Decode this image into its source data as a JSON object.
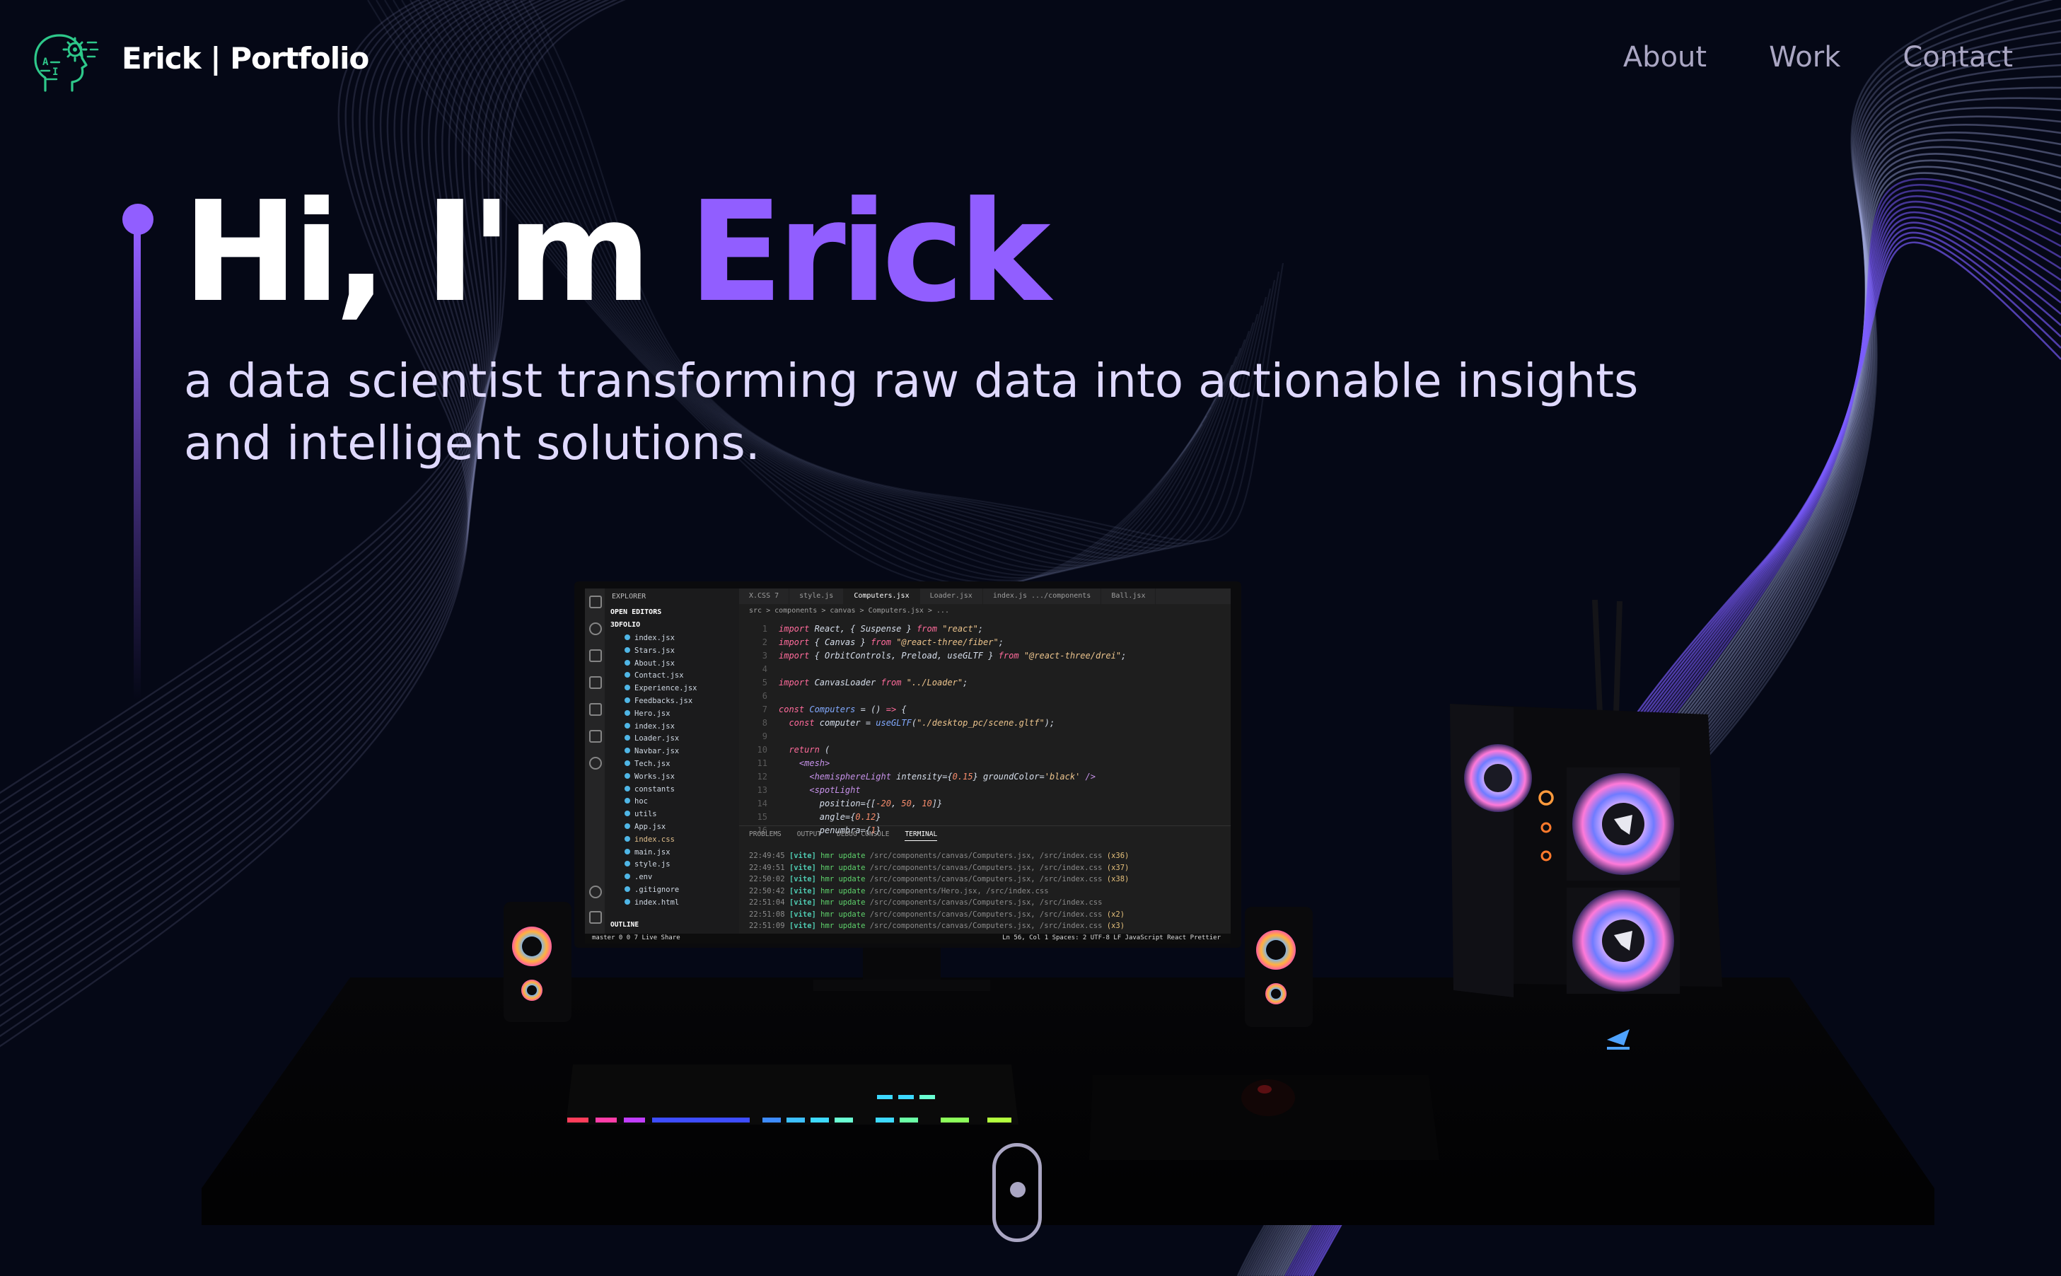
{
  "navbar": {
    "logo_icon": "ai-brain-head-icon",
    "brand": "Erick | Portfolio",
    "links": [
      {
        "label": "About"
      },
      {
        "label": "Work"
      },
      {
        "label": "Contact"
      }
    ]
  },
  "hero": {
    "title_prefix": "Hi, I'm ",
    "title_name": "Erick",
    "subtitle": "a data scientist transforming raw data into actionable insights and intelligent solutions."
  },
  "colors": {
    "background": "#050816",
    "accent": "#915eff",
    "nav_text": "#aaa6c3",
    "subtitle": "#dfd9ff"
  },
  "scene": {
    "editor": {
      "explorer_label": "EXPLORER",
      "open_editors": "OPEN EDITORS",
      "folder": "3DFOLIO",
      "files": [
        "index.jsx",
        "Stars.jsx",
        "About.jsx",
        "Contact.jsx",
        "Experience.jsx",
        "Feedbacks.jsx",
        "Hero.jsx",
        "index.jsx",
        "Loader.jsx",
        "Navbar.jsx",
        "Tech.jsx",
        "Works.jsx",
        "constants",
        "hoc",
        "utils",
        "App.jsx",
        "index.css",
        "main.jsx",
        "style.js",
        ".env",
        ".gitignore",
        "index.html"
      ],
      "outline_label": "OUTLINE",
      "tabs": [
        "X.CSS 7",
        "style.js",
        "Computers.jsx",
        "Loader.jsx",
        "index.js .../components",
        "Ball.jsx"
      ],
      "active_tab": "Computers.jsx",
      "breadcrumb": "src > components > canvas > Computers.jsx > ...",
      "panel_tabs": [
        "PROBLEMS",
        "OUTPUT",
        "DEBUG CONSOLE",
        "TERMINAL"
      ],
      "terminal_lines": [
        {
          "time": "22:49:45",
          "file": "/src/components/canvas/Computers.jsx, /src/index.css",
          "count": "(x36)"
        },
        {
          "time": "22:49:51",
          "file": "/src/components/canvas/Computers.jsx, /src/index.css",
          "count": "(x37)"
        },
        {
          "time": "22:50:02",
          "file": "/src/components/canvas/Computers.jsx, /src/index.css",
          "count": "(x38)"
        },
        {
          "time": "22:50:42",
          "file": "/src/components/Hero.jsx, /src/index.css",
          "count": ""
        },
        {
          "time": "22:51:04",
          "file": "/src/components/canvas/Computers.jsx, /src/index.css",
          "count": ""
        },
        {
          "time": "22:51:08",
          "file": "/src/components/canvas/Computers.jsx, /src/index.css",
          "count": "(x2)"
        },
        {
          "time": "22:51:09",
          "file": "/src/components/canvas/Computers.jsx, /src/index.css",
          "count": "(x3)"
        }
      ],
      "status_left": "master  0  0 7  Live Share",
      "status_right": "Ln 56, Col 1   Spaces: 2   UTF-8   LF   JavaScript React   Prettier"
    }
  },
  "scroll_indicator": {
    "icon": "scroll-mouse-icon"
  }
}
